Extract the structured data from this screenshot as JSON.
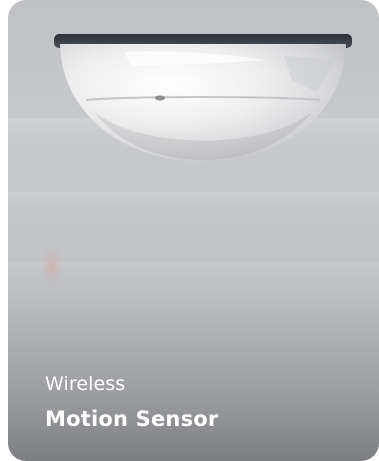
{
  "card": {
    "subtitle": "Wireless",
    "title": "Motion Sensor",
    "image_icon": "motion-sensor-image"
  }
}
